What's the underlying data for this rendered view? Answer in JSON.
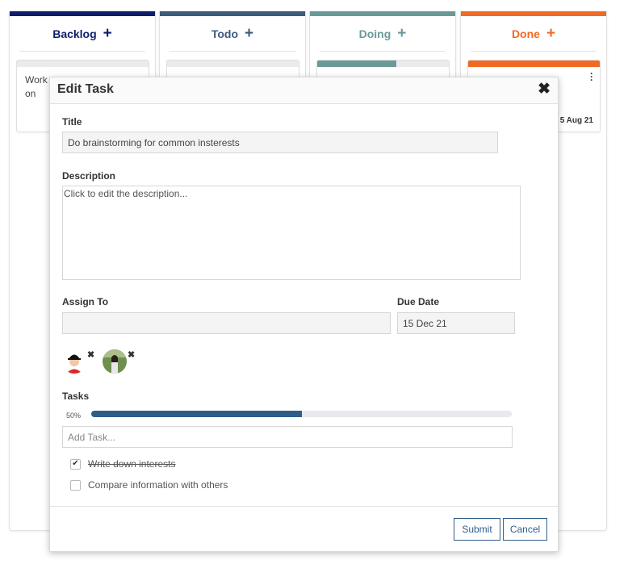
{
  "columns": [
    {
      "name": "Backlog",
      "color": "#0f1c6b",
      "card_text": "Work on interests",
      "card_bar_color": "#ebebee"
    },
    {
      "name": "Todo",
      "color": "#3e5a7d",
      "card_bar_color": "#ebebee"
    },
    {
      "name": "Doing",
      "color": "#6a9a98",
      "card_bar_color": "#6a9a98",
      "card_progress": 0.6
    },
    {
      "name": "Done",
      "color": "#f06a25",
      "card_bar_color": "#f06a25",
      "card_date": "5 Aug 21"
    }
  ],
  "icons": {
    "add": "plus-icon",
    "close": "close-icon",
    "menu": "kebab-menu-icon",
    "check": "checkmark-icon"
  },
  "modal": {
    "title": "Edit Task",
    "close_symbol": "✖",
    "title_label": "Title",
    "title_value": "Do brainstorming for common insterests",
    "description_label": "Description",
    "description_value": "Click to edit the description...",
    "assign_label": "Assign To",
    "assign_value": "",
    "due_label": "Due Date",
    "due_value": "15 Dec 21",
    "assignees": [
      {
        "avatar": "avatar-user-1",
        "remove_symbol": "✖"
      },
      {
        "avatar": "avatar-user-2",
        "remove_symbol": "✖"
      }
    ],
    "tasks_label": "Tasks",
    "progress_text": "50%",
    "progress_value": 0.5,
    "add_task_placeholder": "Add Task...",
    "tasks": [
      {
        "label": "Write down interests",
        "done": true
      },
      {
        "label": "Compare information with others",
        "done": false
      }
    ],
    "submit_label": "Submit",
    "cancel_label": "Cancel",
    "accent_color": "#2f5d8a"
  }
}
